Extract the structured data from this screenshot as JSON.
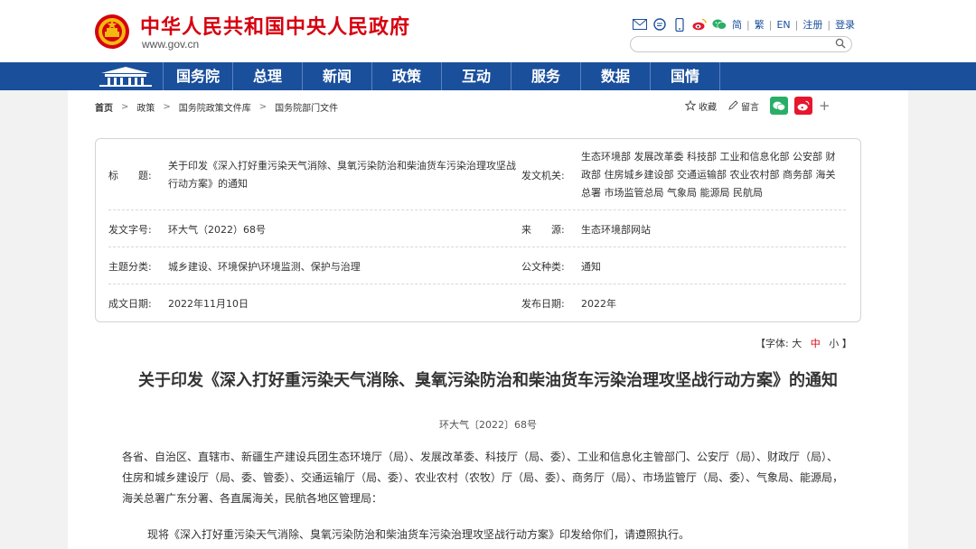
{
  "header": {
    "site_title": "中华人民共和国中央人民政府",
    "site_url": "www.gov.cn",
    "links": [
      "简",
      "繁",
      "EN",
      "注册",
      "登录"
    ],
    "icons": [
      "mail-icon",
      "chat-icon",
      "mobile-icon",
      "weibo-icon",
      "wechat-icon"
    ]
  },
  "nav": {
    "items": [
      "国务院",
      "总理",
      "新闻",
      "政策",
      "互动",
      "服务",
      "数据",
      "国情"
    ]
  },
  "breadcrumb": [
    "首页",
    "政策",
    "国务院政策文件库",
    "国务院部门文件"
  ],
  "tools": {
    "favorite": "收藏",
    "comment": "留言",
    "more": "+"
  },
  "info": {
    "title_label": "标　　题:",
    "title_value": "关于印发《深入打好重污染天气消除、臭氧污染防治和柴油货车污染治理攻坚战行动方案》的通知",
    "issuer_label": "发文机关:",
    "issuer_value": "生态环境部 发展改革委 科技部 工业和信息化部 公安部 财政部 住房城乡建设部 交通运输部 农业农村部 商务部 海关总署 市场监管总局 气象局 能源局 民航局",
    "docno_label": "发文字号:",
    "docno_value": "环大气（2022）68号",
    "source_label": "来　　源:",
    "source_value": "生态环境部网站",
    "topic_label": "主题分类:",
    "topic_value": "城乡建设、环境保护\\环境监测、保护与治理",
    "type_label": "公文种类:",
    "type_value": "通知",
    "date_label": "成文日期:",
    "date_value": "2022年11月10日",
    "pub_label": "发布日期:",
    "pub_value": "2022年"
  },
  "font_size": {
    "prefix": "【字体:",
    "large": "大",
    "medium": "中",
    "small": "小",
    "suffix": "】"
  },
  "document": {
    "title": "关于印发《深入打好重污染天气消除、臭氧污染防治和柴油货车污染治理攻坚战行动方案》的通知",
    "number": "环大气〔2022〕68号",
    "addressee": "各省、自治区、直辖市、新疆生产建设兵团生态环境厅（局）、发展改革委、科技厅（局、委）、工业和信息化主管部门、公安厅（局）、财政厅（局）、住房和城乡建设厅（局、委、管委）、交通运输厅（局、委）、农业农村（农牧）厅（局、委）、商务厅（局）、市场监管厅（局、委）、气象局、能源局，海关总署广东分署、各直属海关，民航各地区管理局：",
    "body": "现将《深入打好重污染天气消除、臭氧污染防治和柴油货车污染治理攻坚战行动方案》印发给你们，请遵照执行。"
  },
  "colors": {
    "nav_bg": "#1a4f9c",
    "title_red": "#d6000f",
    "wechat_green": "#2aae67",
    "weibo_red": "#e6162d"
  }
}
